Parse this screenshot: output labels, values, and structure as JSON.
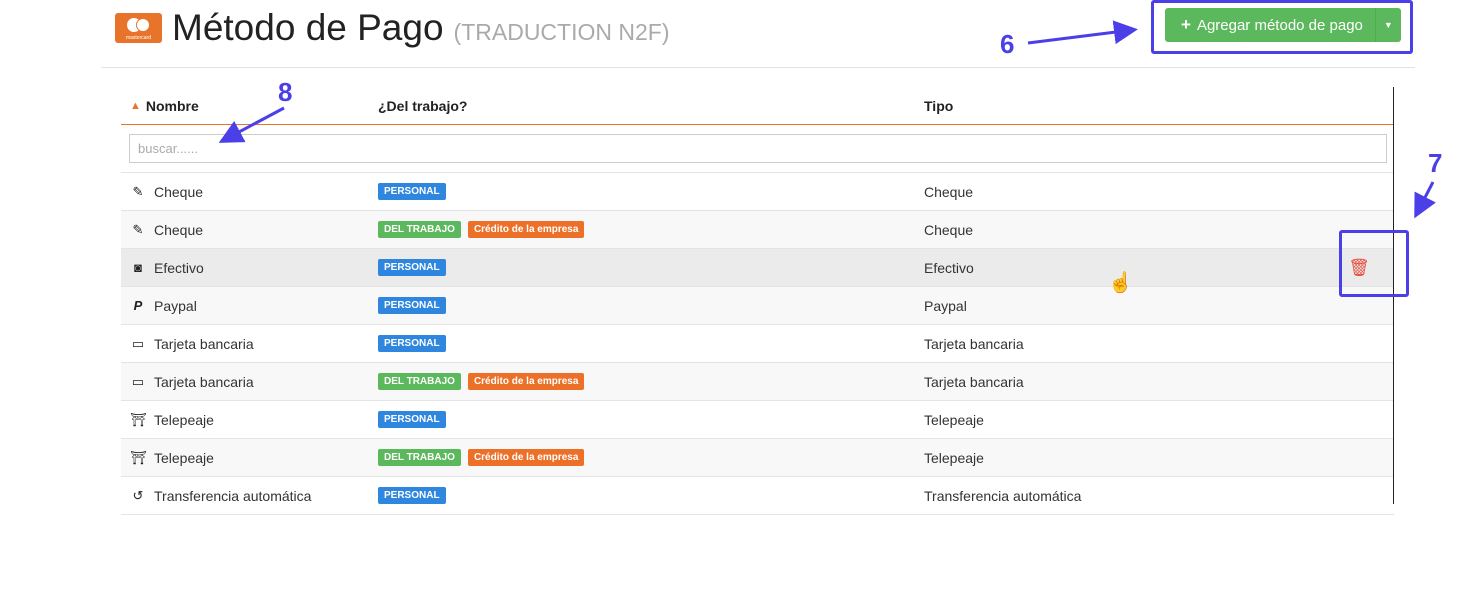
{
  "header": {
    "logo_text": "mastercard",
    "title": "Método de Pago",
    "subtitle": "(TRADUCTION N2F)",
    "add_button_label": "Agregar método de pago",
    "add_button_icon": "plus-icon",
    "dropdown_icon": "caret-down-icon"
  },
  "annotations": {
    "six": "6",
    "seven": "7",
    "eight": "8",
    "color": "#4b3fe8"
  },
  "table": {
    "columns": {
      "name": "Nombre",
      "work": "¿Del trabajo?",
      "type": "Tipo"
    },
    "sort_indicator": "▲",
    "search_placeholder": "buscar......",
    "rows": [
      {
        "icon": "check-icon",
        "name": "Cheque",
        "badges": [
          "PERSONAL"
        ],
        "type": "Cheque"
      },
      {
        "icon": "check-icon",
        "name": "Cheque",
        "badges": [
          "DEL TRABAJO",
          "Crédito de la empresa"
        ],
        "type": "Cheque"
      },
      {
        "icon": "cash-icon",
        "name": "Efectivo",
        "badges": [
          "PERSONAL"
        ],
        "type": "Efectivo",
        "hovered": true
      },
      {
        "icon": "paypal-icon",
        "name": "Paypal",
        "badges": [
          "PERSONAL"
        ],
        "type": "Paypal"
      },
      {
        "icon": "credit-card-icon",
        "name": "Tarjeta bancaria",
        "badges": [
          "PERSONAL"
        ],
        "type": "Tarjeta bancaria"
      },
      {
        "icon": "credit-card-icon",
        "name": "Tarjeta bancaria",
        "badges": [
          "DEL TRABAJO",
          "Crédito de la empresa"
        ],
        "type": "Tarjeta bancaria"
      },
      {
        "icon": "toll-icon",
        "name": "Telepeaje",
        "badges": [
          "PERSONAL"
        ],
        "type": "Telepeaje"
      },
      {
        "icon": "toll-icon",
        "name": "Telepeaje",
        "badges": [
          "DEL TRABAJO",
          "Crédito de la empresa"
        ],
        "type": "Telepeaje"
      },
      {
        "icon": "history-icon",
        "name": "Transferencia automática",
        "badges": [
          "PERSONAL"
        ],
        "type": "Transferencia automática"
      }
    ]
  },
  "colors": {
    "accent": "#e8742c",
    "primary_badge": "#2e86de",
    "work_badge": "#5cb85c",
    "company_badge": "#ec7028",
    "delete": "#e74c3c"
  }
}
